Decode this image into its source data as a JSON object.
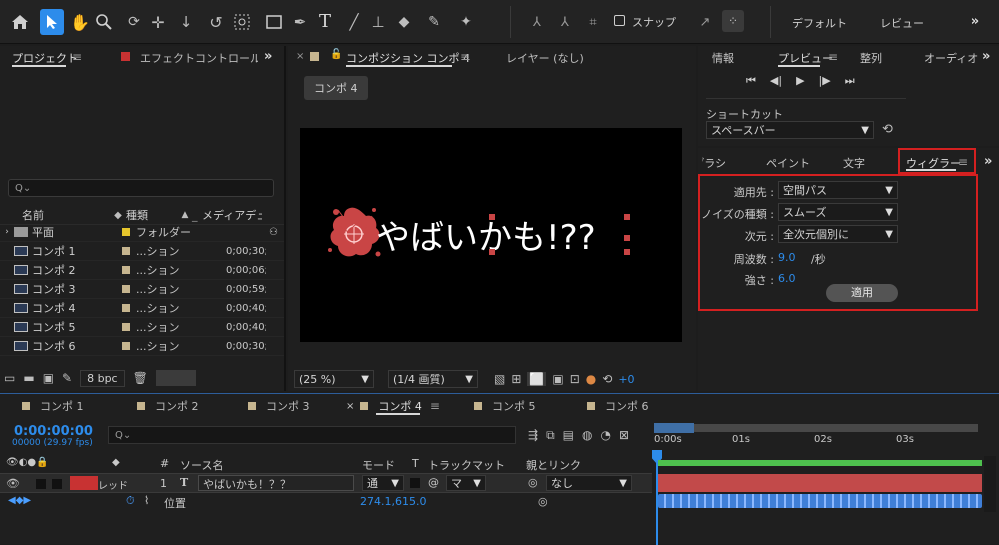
{
  "toolbar": {
    "snap_label": "スナップ",
    "workspace_default": "デフォルト",
    "workspace_review": "レビュー"
  },
  "project_panel": {
    "tab_project": "プロジェクト",
    "tab_effect": "エフェクトコントロール やば",
    "search_placeholder": "Q⌄",
    "columns": {
      "name": "名前",
      "type": "種類",
      "media": "メディアデュ"
    },
    "items": [
      {
        "name": "平面",
        "type": "フォルダー",
        "dur": "",
        "kind": "folder"
      },
      {
        "name": "コンポ 1",
        "type": "...ション",
        "dur": "0;00;30;",
        "kind": "comp"
      },
      {
        "name": "コンポ 2",
        "type": "...ション",
        "dur": "0;00;06;",
        "kind": "comp"
      },
      {
        "name": "コンポ 3",
        "type": "...ション",
        "dur": "0;00;59;",
        "kind": "comp"
      },
      {
        "name": "コンポ 4",
        "type": "...ション",
        "dur": "0;00;40;",
        "kind": "comp"
      },
      {
        "name": "コンポ 5",
        "type": "...ション",
        "dur": "0;00;40;",
        "kind": "comp"
      },
      {
        "name": "コンポ 6",
        "type": "...ション",
        "dur": "0;00;30;",
        "kind": "comp"
      }
    ],
    "bpc": "8 bpc"
  },
  "comp_panel": {
    "tab_label": "コンポジション コンポ 4",
    "layer_tab": "レイヤー (なし)",
    "comp_button": "コンポ 4",
    "canvas_text": "やばいかも!??",
    "zoom": "(25 %)",
    "quality": "(1/4 画質)",
    "exposure": "+0"
  },
  "right_top": {
    "tabs": [
      "情報",
      "プレビュー",
      "整列",
      "オーディオ"
    ],
    "shortcut_label": "ショートカット",
    "shortcut_value": "スペースバー"
  },
  "wiggler": {
    "tabs": [
      "ブラシ",
      "ペイント",
      "文字",
      "ウィグラー"
    ],
    "apply_to_label": "適用先 :",
    "apply_to_value": "空間パス",
    "noise_label": "ノイズの種類 :",
    "noise_value": "スムーズ",
    "dim_label": "次元 :",
    "dim_value": "全次元個別に",
    "freq_label": "周波数 :",
    "freq_value": "9.0",
    "freq_unit": "/秒",
    "strength_label": "強さ :",
    "strength_value": "6.0",
    "apply_button": "適用"
  },
  "timeline": {
    "tabs": [
      "コンポ 1",
      "コンポ 2",
      "コンポ 3",
      "コンポ 4",
      "コンポ 5",
      "コンポ 6"
    ],
    "timecode": "0:00:00:00",
    "fps": "00000 (29.97 fps)",
    "search": "Q⌄",
    "ruler": [
      "0:00s",
      "01s",
      "02s",
      "03s"
    ],
    "cols": {
      "src": "ソース名",
      "mode": "モード",
      "t": "T",
      "trackmatte": "トラックマット",
      "parent": "親とリンク"
    },
    "layer": {
      "color_label": "レッド",
      "num": "1",
      "name": "やばいかも！？？",
      "mode": "通",
      "matte": "マ",
      "parent": "なし"
    },
    "prop": {
      "name": "位置",
      "value": "274.1,615.0"
    }
  }
}
